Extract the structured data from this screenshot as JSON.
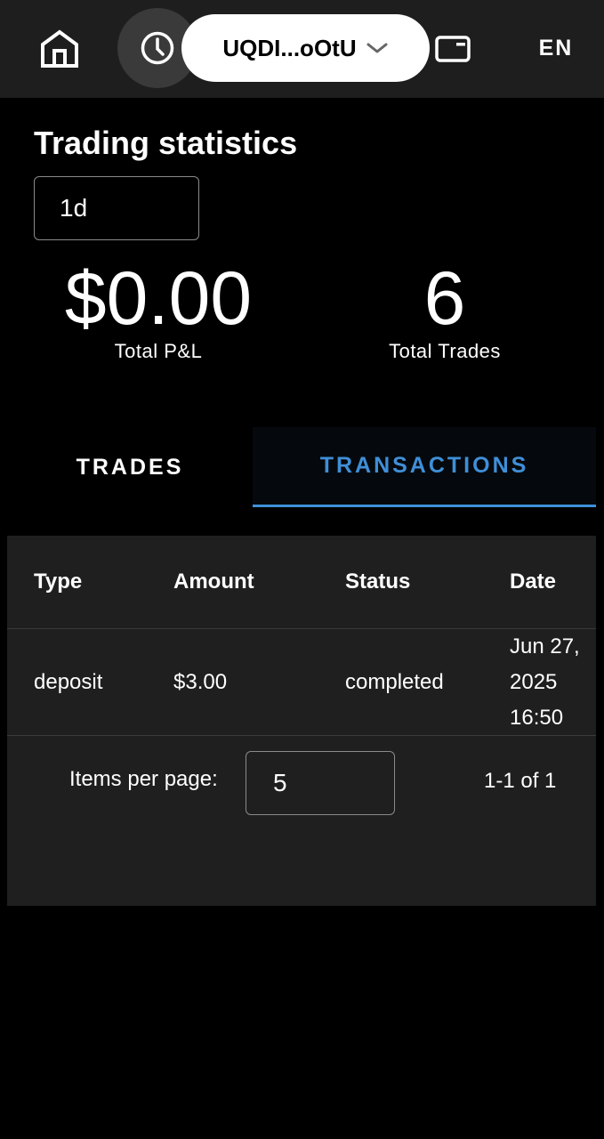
{
  "header": {
    "wallet_label": "UQDI...oOtU",
    "language": "EN",
    "icons": {
      "home": "home-icon",
      "history": "clock-icon",
      "wallet_dropdown": "chevron-down-icon",
      "card": "card-icon"
    }
  },
  "stats": {
    "title": "Trading statistics",
    "period": "1d",
    "pnl_value": "$0.00",
    "pnl_label": "Total P&L",
    "trades_value": "6",
    "trades_label": "Total Trades"
  },
  "tabs": [
    {
      "label": "TRADES",
      "active": false
    },
    {
      "label": "TRANSACTIONS",
      "active": true
    }
  ],
  "table": {
    "columns": [
      "Type",
      "Amount",
      "Status",
      "Date"
    ],
    "rows": [
      {
        "type": "deposit",
        "amount": "$3.00",
        "status": "completed",
        "date_line1": "Jun 27,",
        "date_line2": "2025",
        "date_line3": "16:50"
      }
    ],
    "pagination": {
      "items_per_page_label": "Items per page:",
      "items_per_page": "5",
      "range": "1-1 of 1"
    }
  },
  "colors": {
    "accent": "#3f8fd8",
    "background": "#000000",
    "surface": "#1f1f1f",
    "topbar": "#1e1e1e"
  }
}
